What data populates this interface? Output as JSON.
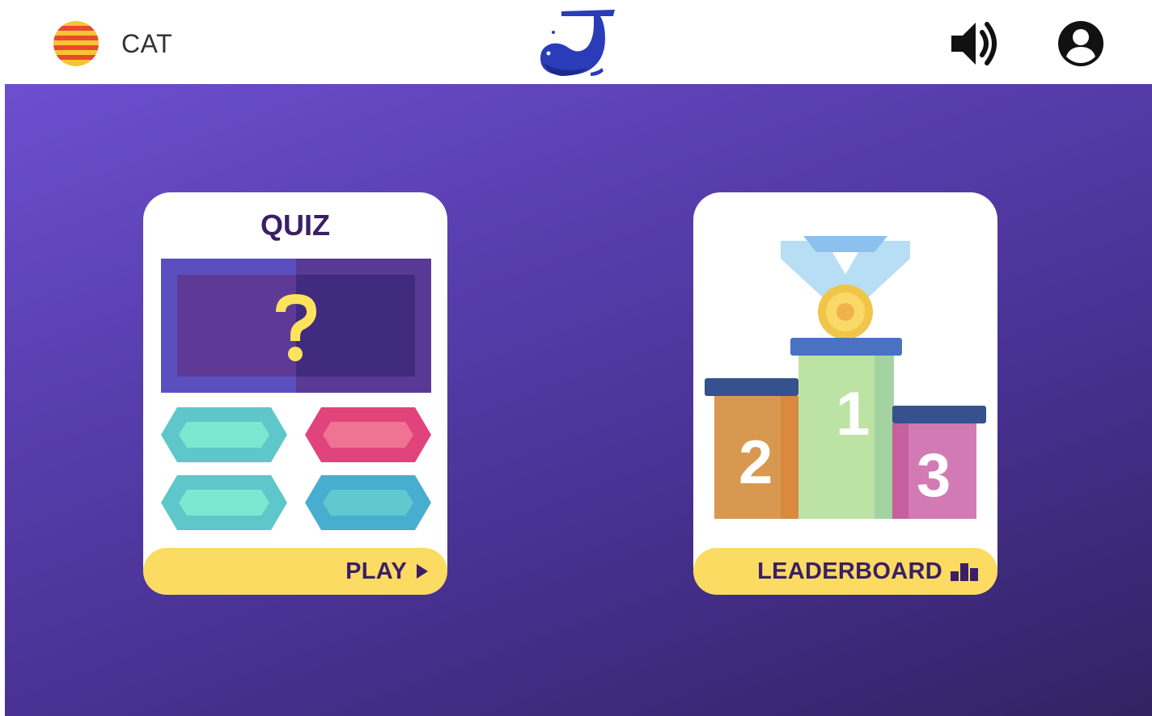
{
  "header": {
    "language_label": "CAT",
    "icons": {
      "flag": "catalan-flag-icon",
      "logo": "whale-logo-icon",
      "sound": "speaker-volume-icon",
      "user": "user-account-icon"
    }
  },
  "cards": {
    "quiz": {
      "title": "QUIZ",
      "button_label": "PLAY",
      "button_icon": "play-triangle-icon"
    },
    "leaderboard": {
      "button_label": "LEADERBOARD",
      "button_icon": "bar-chart-icon",
      "podium": [
        "1",
        "2",
        "3"
      ]
    }
  },
  "colors": {
    "accent_yellow": "#fbdb61",
    "text_dark_purple": "#3a1f66",
    "background_top": "#6d4fcf",
    "background_bottom": "#342263",
    "logo_blue": "#2a3cb8"
  }
}
